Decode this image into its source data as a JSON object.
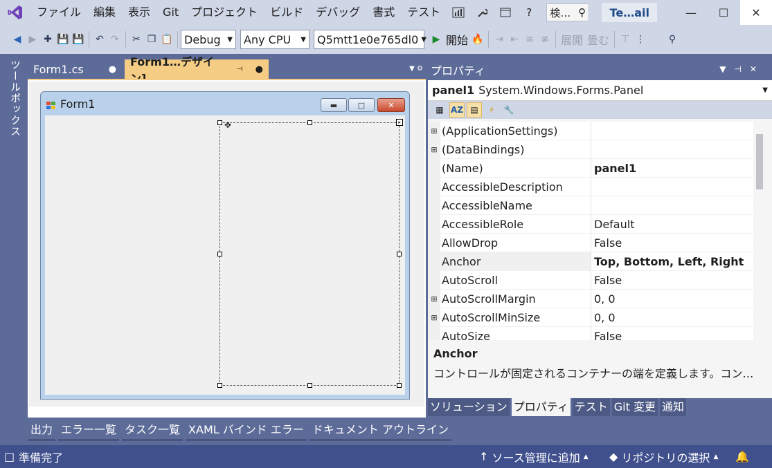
{
  "menu": {
    "items": [
      "ファイル",
      "編集",
      "表示",
      "Git",
      "プロジェクト",
      "ビルド",
      "デバッグ",
      "書式",
      "テスト"
    ],
    "search_placeholder": "検…",
    "help_label": "?",
    "solution_name": "Te…ail"
  },
  "toolbar": {
    "config": "Debug",
    "platform": "Any CPU",
    "project": "Q5mtt1e0e765dl0",
    "start_label": "開始",
    "expand_label": "展開",
    "collapse_label": "畳む"
  },
  "toolbox_label": "ツールボックス",
  "doc_tabs": [
    {
      "label": "Form1.cs",
      "active": false
    },
    {
      "label": "Form1…デザイン]",
      "active": true
    }
  ],
  "designer": {
    "form_title": "Form1"
  },
  "bottom_tabs": [
    "出力",
    "エラー一覧",
    "タスク一覧",
    "XAML バインド エラー",
    "ドキュメント アウトライン"
  ],
  "properties": {
    "title": "プロパティ",
    "object_name": "panel1",
    "object_type": "System.Windows.Forms.Panel",
    "rows": [
      {
        "name": "(ApplicationSettings)",
        "value": "",
        "expandable": true
      },
      {
        "name": "(DataBindings)",
        "value": "",
        "expandable": true
      },
      {
        "name": "(Name)",
        "value": "panel1",
        "bold": true
      },
      {
        "name": "AccessibleDescription",
        "value": ""
      },
      {
        "name": "AccessibleName",
        "value": ""
      },
      {
        "name": "AccessibleRole",
        "value": "Default"
      },
      {
        "name": "AllowDrop",
        "value": "False"
      },
      {
        "name": "Anchor",
        "value": "Top, Bottom, Left, Right",
        "bold": true,
        "selected": true
      },
      {
        "name": "AutoScroll",
        "value": "False"
      },
      {
        "name": "AutoScrollMargin",
        "value": "0, 0",
        "expandable": true
      },
      {
        "name": "AutoScrollMinSize",
        "value": "0, 0",
        "expandable": true
      },
      {
        "name": "AutoSize",
        "value": "False"
      }
    ],
    "desc_title": "Anchor",
    "desc_text": "コントロールが固定されるコンテナーの端を定義します。コン…"
  },
  "right_tabs": [
    {
      "label": "ソリューション",
      "active": false
    },
    {
      "label": "プロパティ",
      "active": true
    },
    {
      "label": "テスト",
      "active": false
    },
    {
      "label": "Git 変更",
      "active": false
    },
    {
      "label": "通知",
      "active": false
    }
  ],
  "status": {
    "ready": "準備完了",
    "add_source_control": "ソース管理に追加",
    "select_repo": "リポジトリの選択"
  }
}
